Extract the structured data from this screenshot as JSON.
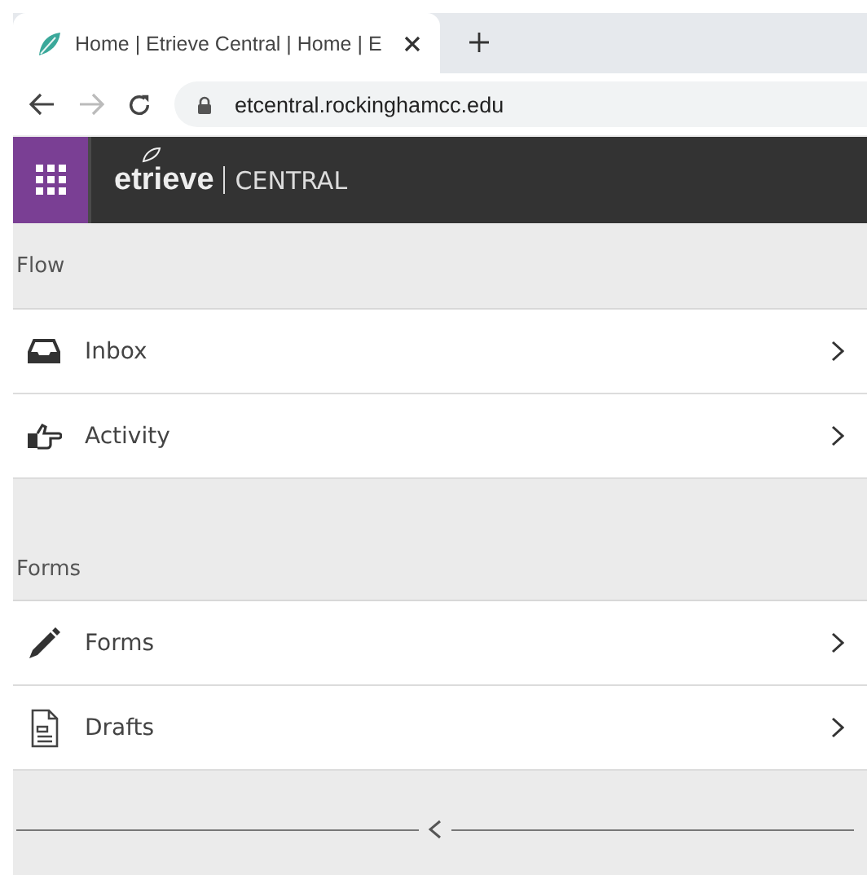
{
  "browser": {
    "tab": {
      "title": "Home | Etrieve Central | Home | E",
      "selected": true
    },
    "url": "etcentral.rockinghamcc.edu"
  },
  "header": {
    "brand": "etrieve",
    "product": "CENTRAL"
  },
  "sections": [
    {
      "title": "Flow",
      "items": [
        {
          "label": "Inbox"
        },
        {
          "label": "Activity"
        }
      ]
    },
    {
      "title": "Forms",
      "items": [
        {
          "label": "Forms"
        },
        {
          "label": "Drafts"
        }
      ]
    }
  ]
}
